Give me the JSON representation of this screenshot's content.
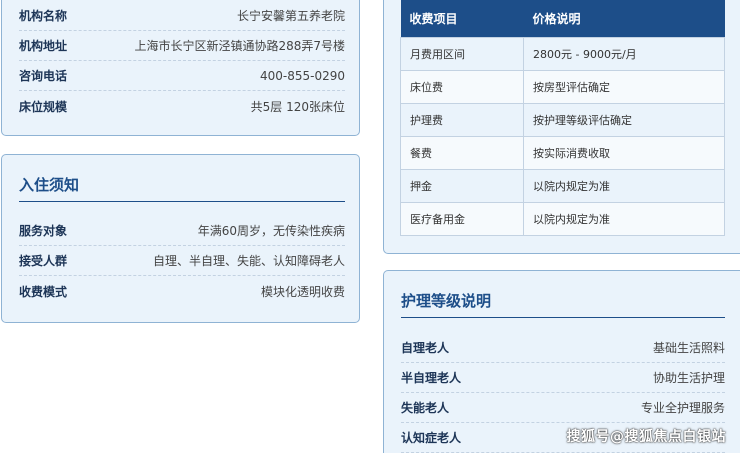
{
  "basic_info": {
    "rows": [
      {
        "key": "机构名称",
        "value": "长宁安馨第五养老院"
      },
      {
        "key": "机构地址",
        "value": "上海市长宁区新泾镇通协路288弄7号楼"
      },
      {
        "key": "咨询电话",
        "value": "400-855-0290"
      },
      {
        "key": "床位规模",
        "value": "共5层 120张床位"
      }
    ]
  },
  "admission": {
    "title": "入住须知",
    "rows": [
      {
        "key": "服务对象",
        "value": "年满60周岁，无传染性疾病"
      },
      {
        "key": "接受人群",
        "value": "自理、半自理、失能、认知障碍老人"
      },
      {
        "key": "收费模式",
        "value": "模块化透明收费"
      }
    ]
  },
  "fees": {
    "headers": [
      "收费项目",
      "价格说明"
    ],
    "rows": [
      [
        "月费用区间",
        "2800元 - 9000元/月"
      ],
      [
        "床位费",
        "按房型评估确定"
      ],
      [
        "护理费",
        "按护理等级评估确定"
      ],
      [
        "餐费",
        "按实际消费收取"
      ],
      [
        "押金",
        "以院内规定为准"
      ],
      [
        "医疗备用金",
        "以院内规定为准"
      ]
    ]
  },
  "care_levels": {
    "title": "护理等级说明",
    "rows": [
      {
        "key": "自理老人",
        "value": "基础生活照料"
      },
      {
        "key": "半自理老人",
        "value": "协助生活护理"
      },
      {
        "key": "失能老人",
        "value": "专业全护理服务"
      },
      {
        "key": "认知症老人",
        "value": ""
      }
    ]
  },
  "watermark": "搜狐号@搜狐焦点白银站",
  "colors": {
    "accent": "#1d4e89",
    "card_bg": "#eaf3fb",
    "card_border": "#8fb3d4"
  }
}
